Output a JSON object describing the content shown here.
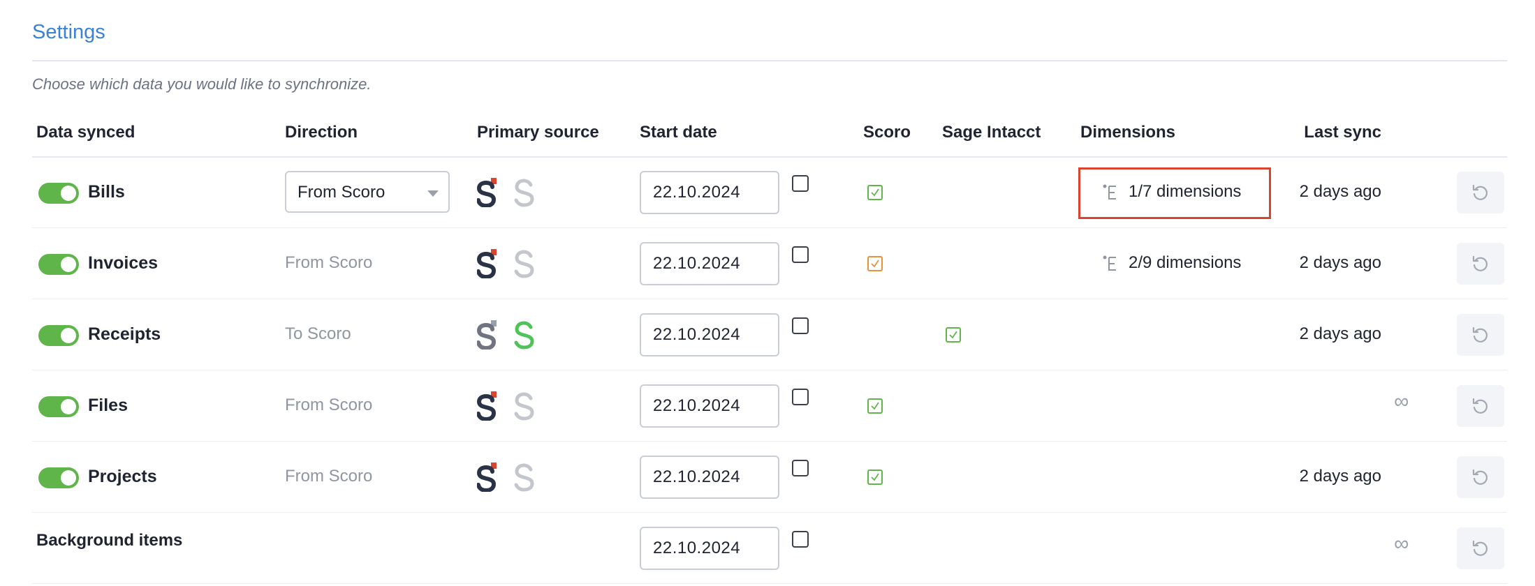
{
  "page": {
    "title": "Settings",
    "subtitle": "Choose which data you would like to synchronize."
  },
  "columns": {
    "data_synced": "Data synced",
    "direction": "Direction",
    "primary_source": "Primary source",
    "start_date": "Start date",
    "scoro": "Scoro",
    "sage_intacct": "Sage Intacct",
    "dimensions": "Dimensions",
    "last_sync": "Last sync"
  },
  "rows": [
    {
      "label": "Bills",
      "enabled": true,
      "direction": "From Scoro",
      "direction_is_select": true,
      "primary_source": "scoro",
      "start_date": "22.10.2024",
      "scoro_checked": "green",
      "sage_checked": null,
      "dimensions": "1/7 dimensions",
      "last_sync": "2 days ago"
    },
    {
      "label": "Invoices",
      "enabled": true,
      "direction": "From Scoro",
      "direction_is_select": false,
      "primary_source": "scoro",
      "start_date": "22.10.2024",
      "scoro_checked": "orange",
      "sage_checked": null,
      "dimensions": "2/9 dimensions",
      "last_sync": "2 days ago"
    },
    {
      "label": "Receipts",
      "enabled": true,
      "direction": "To Scoro",
      "direction_is_select": false,
      "primary_source": "sage",
      "start_date": "22.10.2024",
      "scoro_checked": null,
      "sage_checked": "green",
      "dimensions": "",
      "last_sync": "2 days ago"
    },
    {
      "label": "Files",
      "enabled": true,
      "direction": "From Scoro",
      "direction_is_select": false,
      "primary_source": "scoro",
      "start_date": "22.10.2024",
      "scoro_checked": "green",
      "sage_checked": null,
      "dimensions": "",
      "last_sync": "∞"
    },
    {
      "label": "Projects",
      "enabled": true,
      "direction": "From Scoro",
      "direction_is_select": false,
      "primary_source": "scoro",
      "start_date": "22.10.2024",
      "scoro_checked": "green",
      "sage_checked": null,
      "dimensions": "",
      "last_sync": "2 days ago"
    },
    {
      "label": "Background items",
      "start_date": "22.10.2024",
      "last_sync": "∞"
    }
  ],
  "icons": {
    "toggle": "toggle-on-icon",
    "scoro_logo": "scoro-logo-icon",
    "sage_logo": "sage-intacct-logo-icon",
    "dimensions": "dimensions-tree-icon",
    "reset": "reset-sync-icon",
    "infinity": "infinity-icon"
  },
  "colors": {
    "accent": "#3a82d6",
    "toggle_on": "#5fb54a",
    "check_green": "#5fb54a",
    "check_orange": "#e8913a",
    "highlight": "#d9452f",
    "scoro_dark": "#2a3345",
    "scoro_red": "#d9452f",
    "sage_green": "#4fc35a",
    "inactive_logo": "#c3c6cc"
  }
}
